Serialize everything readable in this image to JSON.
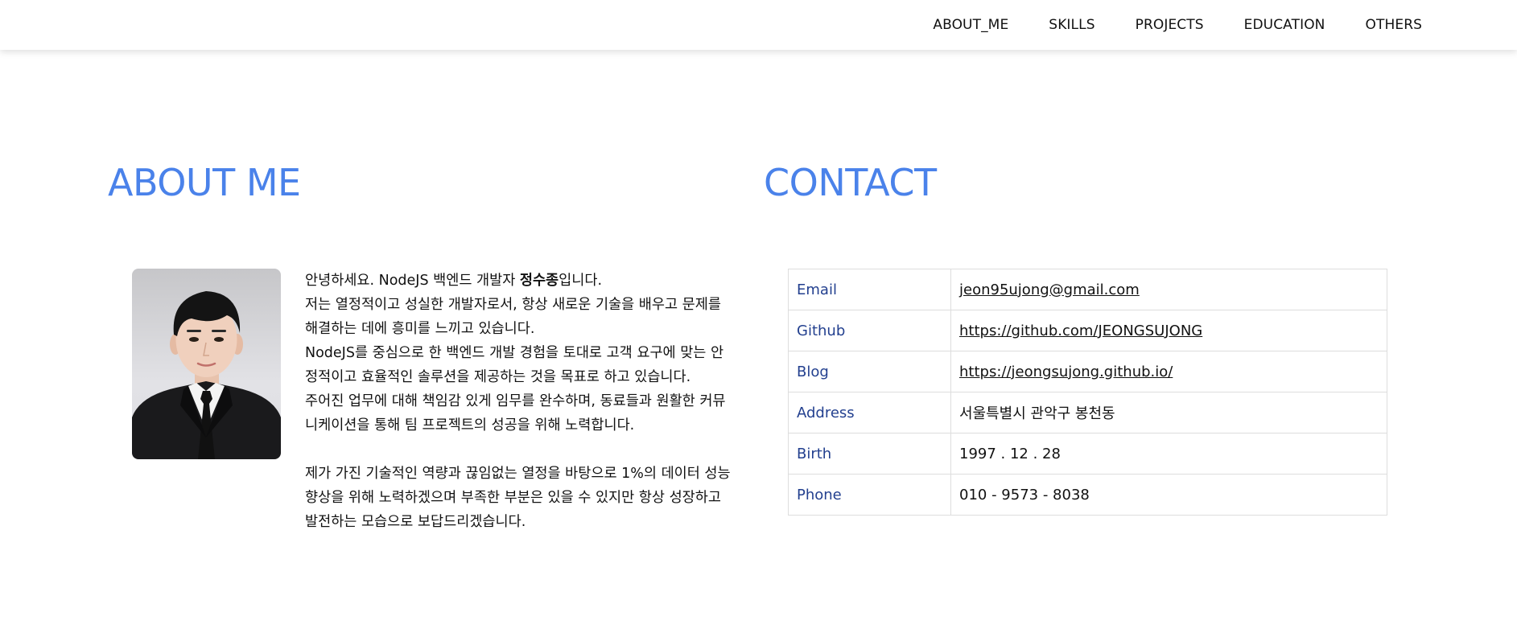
{
  "nav": {
    "items": [
      {
        "label": "ABOUT_ME"
      },
      {
        "label": "SKILLS"
      },
      {
        "label": "PROJECTS"
      },
      {
        "label": "EDUCATION"
      },
      {
        "label": "OTHERS"
      }
    ]
  },
  "about": {
    "title": "ABOUT ME",
    "intro_prefix": "안녕하세요. NodeJS 백엔드 개발자 ",
    "name": "정수종",
    "intro_suffix": "입니다.",
    "p2": "저는 열정적이고 성실한 개발자로서, 항상 새로운 기술을 배우고 문제를 해결하는 데에 흥미를 느끼고 있습니다.",
    "p3": "NodeJS를 중심으로 한 백엔드 개발 경험을 토대로 고객 요구에 맞는 안정적이고 효율적인 솔루션을 제공하는 것을 목표로 하고 있습니다.",
    "p4": "주어진 업무에 대해 책임감 있게 임무를 완수하며, 동료들과 원활한 커뮤니케이션을 통해 팀 프로젝트의 성공을 위해 노력합니다.",
    "p5": "제가 가진 기술적인 역량과 끊임없는 열정을 바탕으로 1%의 데이터 성능 향상을 위해 노력하겠으며 부족한 부분은 있을 수 있지만 항상 성장하고 발전하는 모습으로 보답드리겠습니다."
  },
  "contact": {
    "title": "CONTACT",
    "rows": [
      {
        "label": "Email",
        "value": "jeon95ujong@gmail.com"
      },
      {
        "label": "Github",
        "value": "https://github.com/JEONGSUJONG"
      },
      {
        "label": "Blog",
        "value": "https://jeongsujong.github.io/"
      },
      {
        "label": "Address",
        "value": "서울특별시 관악구 봉천동"
      },
      {
        "label": "Birth",
        "value": "1997 . 12 . 28"
      },
      {
        "label": "Phone",
        "value": "010 - 9573 - 8038"
      }
    ]
  },
  "colors": {
    "accent": "#4a82ea",
    "label": "#23408f"
  }
}
